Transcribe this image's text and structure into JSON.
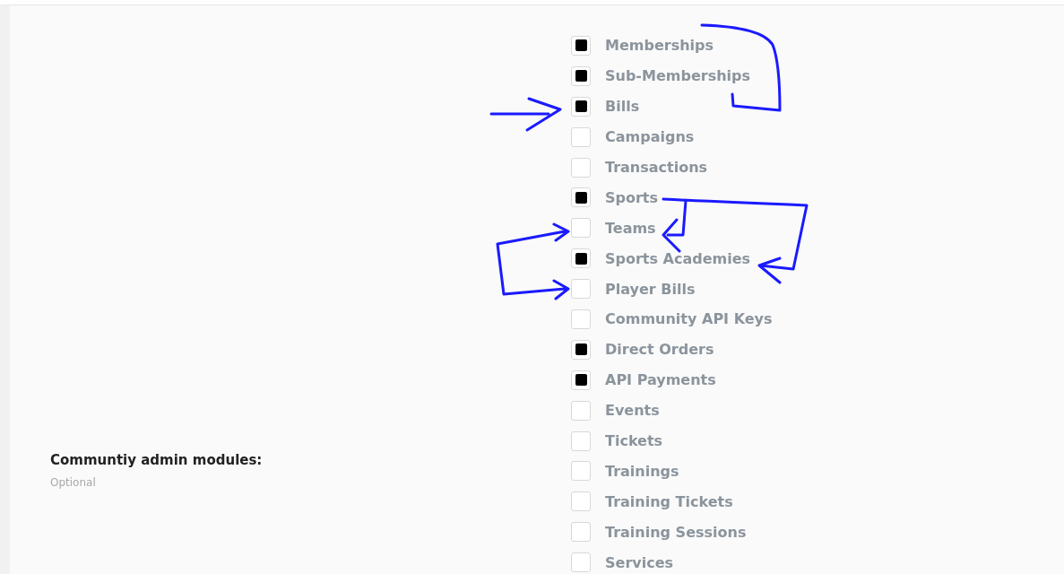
{
  "field": {
    "label": "Communtiy admin modules:",
    "hint": "Optional"
  },
  "modules": [
    {
      "label": "Memberships",
      "checked": true
    },
    {
      "label": "Sub-Memberships",
      "checked": true
    },
    {
      "label": "Bills",
      "checked": true
    },
    {
      "label": "Campaigns",
      "checked": false
    },
    {
      "label": "Transactions",
      "checked": false
    },
    {
      "label": "Sports",
      "checked": true
    },
    {
      "label": "Teams",
      "checked": false
    },
    {
      "label": "Sports Academies",
      "checked": true
    },
    {
      "label": "Player Bills",
      "checked": false
    },
    {
      "label": "Community API Keys",
      "checked": false
    },
    {
      "label": "Direct Orders",
      "checked": true
    },
    {
      "label": "API Payments",
      "checked": true
    },
    {
      "label": "Events",
      "checked": false
    },
    {
      "label": "Tickets",
      "checked": false
    },
    {
      "label": "Trainings",
      "checked": false
    },
    {
      "label": "Training Tickets",
      "checked": false
    },
    {
      "label": "Training Sessions",
      "checked": false
    },
    {
      "label": "Services",
      "checked": false
    }
  ]
}
